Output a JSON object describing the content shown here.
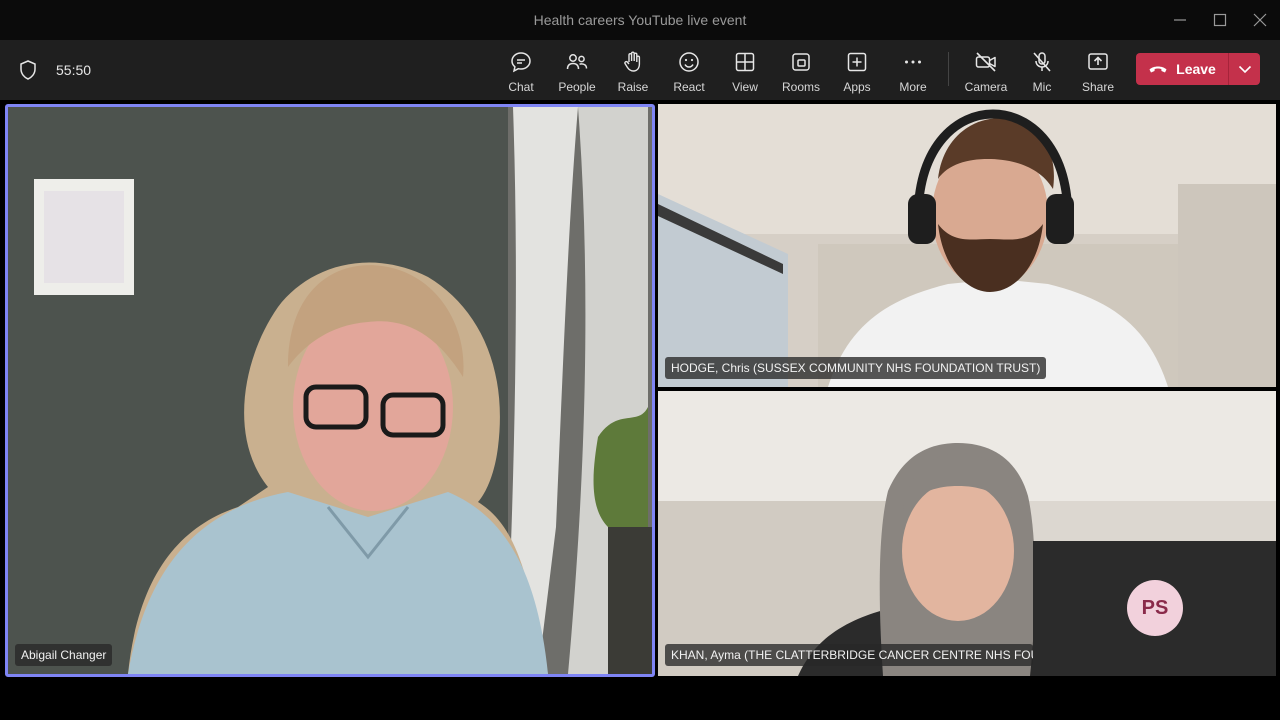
{
  "window": {
    "title": "Health careers YouTube live event"
  },
  "meeting": {
    "timer": "55:50",
    "toolbar": [
      {
        "id": "chat",
        "label": "Chat",
        "icon": "chat-icon"
      },
      {
        "id": "people",
        "label": "People",
        "icon": "people-icon"
      },
      {
        "id": "raise",
        "label": "Raise",
        "icon": "hand-icon"
      },
      {
        "id": "react",
        "label": "React",
        "icon": "smiley-icon"
      },
      {
        "id": "view",
        "label": "View",
        "icon": "grid-icon"
      },
      {
        "id": "rooms",
        "label": "Rooms",
        "icon": "rooms-icon"
      },
      {
        "id": "apps",
        "label": "Apps",
        "icon": "plus-square-icon"
      },
      {
        "id": "more",
        "label": "More",
        "icon": "ellipsis-icon"
      },
      {
        "id": "camera",
        "label": "Camera",
        "icon": "camera-off-icon"
      },
      {
        "id": "mic",
        "label": "Mic",
        "icon": "mic-off-icon"
      },
      {
        "id": "share",
        "label": "Share",
        "icon": "share-tray-icon"
      }
    ],
    "leave_label": "Leave",
    "leave_color": "#c4314b",
    "active_speaker_color": "#7f85f5"
  },
  "participants": {
    "main": {
      "name": "Abigail Changer"
    },
    "top_right": {
      "name": "HODGE, Chris (SUSSEX COMMUNITY NHS FOUNDATION TRUST)"
    },
    "bottom_right": {
      "name": "KHAN, Ayma (THE CLATTERBRIDGE CANCER CENTRE NHS FOUNDATION TRUST)"
    },
    "avatar_tile": {
      "initials": "PS"
    }
  }
}
